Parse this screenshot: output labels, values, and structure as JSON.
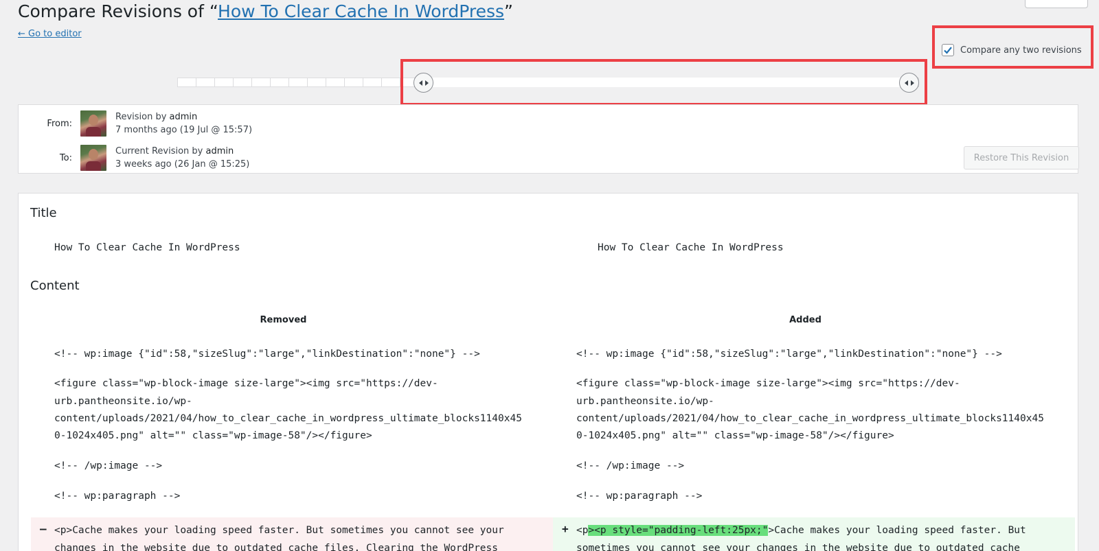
{
  "header": {
    "title_prefix": "Compare Revisions of “",
    "title_link": "How To Clear Cache In WordPress",
    "title_suffix": "”",
    "back_link": "← Go to editor"
  },
  "compare": {
    "label": "Compare any two revisions",
    "checked": true
  },
  "meta": {
    "from": {
      "label": "From:",
      "revision_prefix": "Revision by ",
      "author": "admin",
      "time": "7 months ago (19 Jul @ 15:57)"
    },
    "to": {
      "label": "To:",
      "revision_prefix": "Current Revision by ",
      "author": "admin",
      "time": "3 weeks ago (26 Jan @ 15:25)"
    },
    "restore_button": "Restore This Revision"
  },
  "diff": {
    "title_heading": "Title",
    "title_old": "How To Clear Cache In WordPress",
    "title_new": "How To Clear Cache In WordPress",
    "content_heading": "Content",
    "removed_heading": "Removed",
    "added_heading": "Added",
    "lines_left": [
      "<!-- wp:image {\"id\":58,\"sizeSlug\":\"large\",\"linkDestination\":\"none\"} -->",
      "<figure class=\"wp-block-image size-large\"><img src=\"https://dev-",
      "urb.pantheonsite.io/wp-",
      "content/uploads/2021/04/how_to_clear_cache_in_wordpress_ultimate_blocks1140x45",
      "0-1024x405.png\" alt=\"\" class=\"wp-image-58\"/></figure>",
      "<!-- /wp:image -->",
      "<!-- wp:paragraph -->"
    ],
    "lines_right": [
      "<!-- wp:image {\"id\":58,\"sizeSlug\":\"large\",\"linkDestination\":\"none\"} -->",
      "<figure class=\"wp-block-image size-large\"><img src=\"https://dev-",
      "urb.pantheonsite.io/wp-",
      "content/uploads/2021/04/how_to_clear_cache_in_wordpress_ultimate_blocks1140x45",
      "0-1024x405.png\" alt=\"\" class=\"wp-image-58\"/></figure>",
      "<!-- /wp:image -->",
      "<!-- wp:paragraph -->"
    ],
    "removed_sign": "–",
    "removed_line1": "<p>Cache makes your loading speed faster. But sometimes you cannot see your",
    "removed_line2": "changes in the website due to outdated cache files. Clearing the WordPress",
    "added_sign": "+",
    "added_prefix": "<p",
    "added_inserted": "><p style=\"padding-left:25px;\"",
    "added_rest": ">Cache makes your loading speed faster. But",
    "added_line2": "sometimes you cannot see your changes in the website due to outdated cache"
  },
  "slider": {
    "tick_count": 40
  }
}
